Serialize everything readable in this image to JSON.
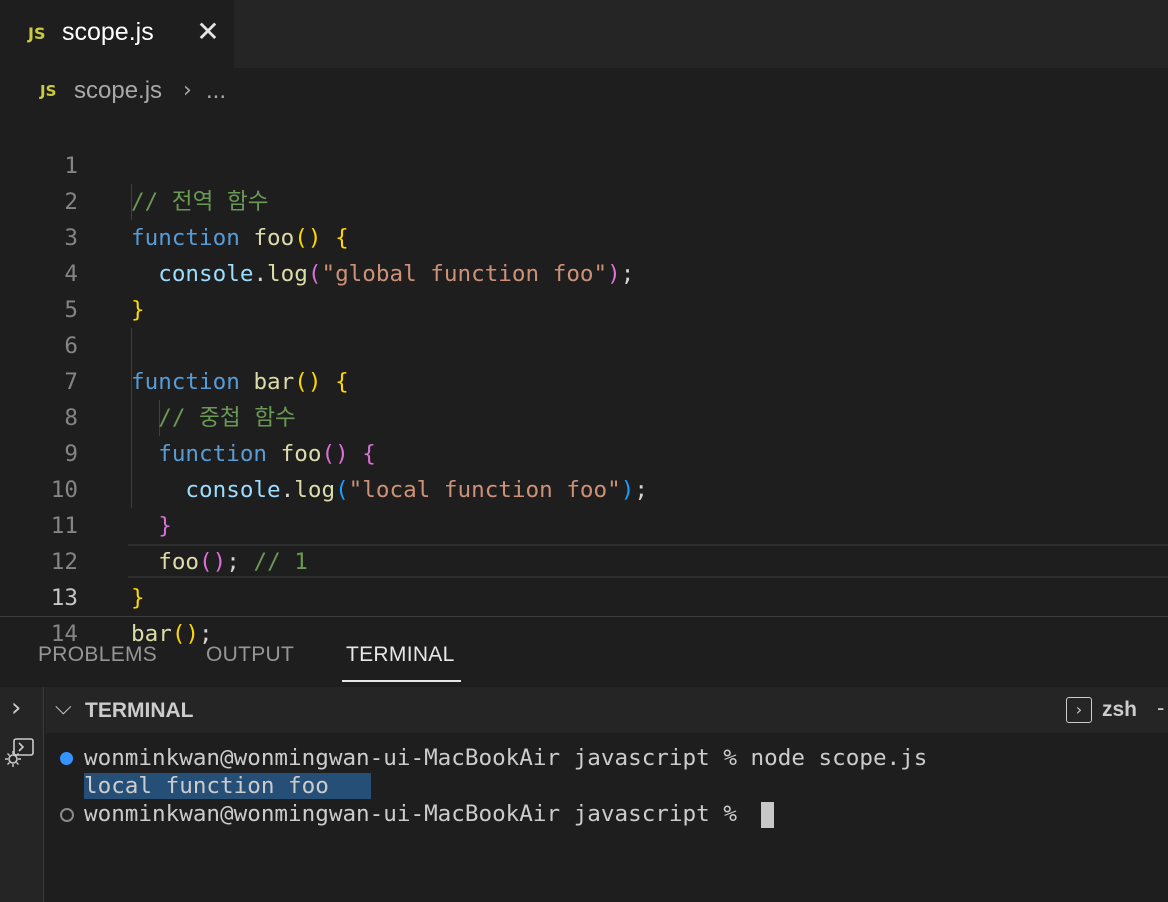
{
  "tab": {
    "icon": "JS",
    "title": "scope.js",
    "close": "✕"
  },
  "breadcrumb": {
    "icon": "JS",
    "file": "scope.js",
    "chevron": "›",
    "more": "..."
  },
  "editor": {
    "line_numbers": [
      "1",
      "2",
      "3",
      "4",
      "5",
      "6",
      "7",
      "8",
      "9",
      "10",
      "11",
      "12",
      "13",
      "14"
    ],
    "active_line": "13",
    "lines": {
      "l1": {
        "comment": "// 전역 함수"
      },
      "l2": {
        "kw": "function",
        "name": "foo",
        "paren": "()",
        "brace": "{"
      },
      "l3": {
        "obj": "console",
        "dot": ".",
        "method": "log",
        "open": "(",
        "str": "\"global function foo\"",
        "close": ")",
        "semi": ";"
      },
      "l4": {
        "brace": "}"
      },
      "l6": {
        "kw": "function",
        "name": "bar",
        "paren": "()",
        "brace": "{"
      },
      "l7": {
        "comment": "// 중첩 함수"
      },
      "l8": {
        "kw": "function",
        "name": "foo",
        "paren": "()",
        "brace": "{"
      },
      "l9": {
        "obj": "console",
        "dot": ".",
        "method": "log",
        "open": "(",
        "str": "\"local function foo\"",
        "close": ")",
        "semi": ";"
      },
      "l10": {
        "brace": "}"
      },
      "l11": {
        "name": "foo",
        "paren": "()",
        "semi": ";",
        "comment": "// 1"
      },
      "l12": {
        "brace": "}"
      },
      "l13": {
        "name": "bar",
        "paren": "()",
        "semi": ";"
      }
    }
  },
  "panel": {
    "tabs": [
      "PROBLEMS",
      "OUTPUT",
      "TERMINAL"
    ],
    "active_tab": "TERMINAL",
    "terminal_title": "TERMINAL",
    "shell": "zsh",
    "header_chevron": "⌵",
    "activity_chevron": "›",
    "shell_icon_glyph": "›",
    "dash": "-"
  },
  "terminal": {
    "line1": "wonminkwan@wonmingwan-ui-MacBookAir javascript % node scope.js",
    "line2": "local function foo",
    "line3": "wonminkwan@wonmingwan-ui-MacBookAir javascript % "
  },
  "colors": {
    "editor_bg": "#1e1e1e",
    "keyword": "#569cd6",
    "function": "#dcdcaa",
    "string": "#ce9178",
    "comment": "#6a9955",
    "js_badge": "#cbcb41",
    "selection": "#264f78"
  }
}
